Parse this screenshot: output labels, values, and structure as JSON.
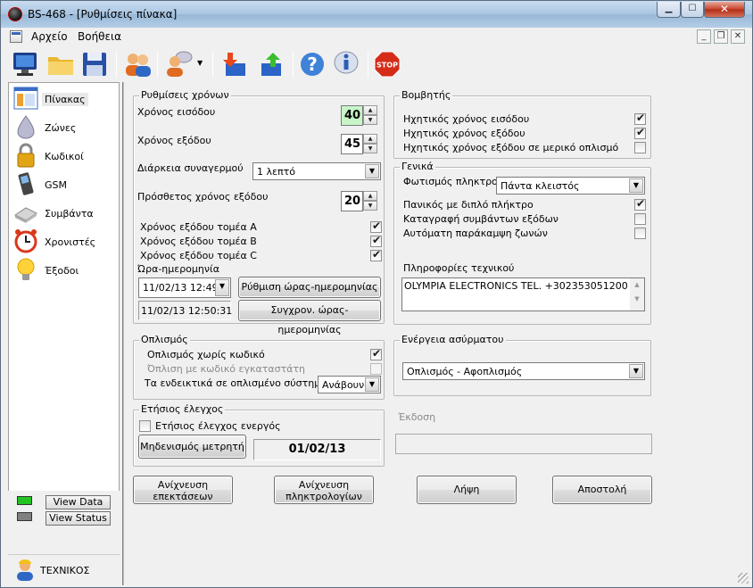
{
  "window": {
    "title": "BS-468 - [Ρυθμίσεις πίνακα]"
  },
  "menu": {
    "file": "Αρχείο",
    "help": "Βοήθεια"
  },
  "nav": {
    "items": [
      {
        "label": "Πίνακας",
        "icon": "panel-icon"
      },
      {
        "label": "Ζώνες",
        "icon": "zones-icon"
      },
      {
        "label": "Κωδικοί",
        "icon": "lock-icon"
      },
      {
        "label": "GSM",
        "icon": "phone-icon"
      },
      {
        "label": "Συμβάντα",
        "icon": "events-icon"
      },
      {
        "label": "Χρονιστές",
        "icon": "alarm-clock-icon"
      },
      {
        "label": "Έξοδοι",
        "icon": "lightbulb-icon"
      }
    ],
    "view_data": "View Data",
    "view_status": "View Status",
    "user": "ΤΕΧΝΙΚΟΣ"
  },
  "timers": {
    "title": "Ρυθμίσεις χρόνων",
    "entry_label": "Χρόνος εισόδου",
    "entry_value": "40",
    "exit_label": "Χρόνος εξόδου",
    "exit_value": "45",
    "alarm_duration_label": "Διάρκεια συναγερμού",
    "alarm_duration_value": "1 λεπτό",
    "extra_exit_label": "Πρόσθετος χρόνος εξόδου",
    "extra_exit_value": "20",
    "sector_a_label": "Χρόνος εξόδου τομέα A",
    "sector_b_label": "Χρόνος εξόδου τομέα B",
    "sector_c_label": "Χρόνος εξόδου τομέα C",
    "datetime_label": "Ώρα-ημερομηνία",
    "datetime_picker": "11/02/13  12:49",
    "datetime_current": "11/02/13   12:50:31",
    "set_datetime_btn": "Ρύθμιση ώρας-ημερομηνίας",
    "sync_datetime_btn": "Συγχρον. ώρας-ημερομηνίας"
  },
  "arming": {
    "title": "Οπλισμός",
    "no_code_label": "Οπλισμός χωρίς κωδικό",
    "installer_code_label": "Όπλιση με κωδικό εγκαταστάτη",
    "indicators_label": "Τα ενδεικτικά σε οπλισμένο σύστημα",
    "indicators_value": "Ανάβουν"
  },
  "annual": {
    "title": "Ετήσιος έλεγχος",
    "active_label": "Ετήσιος έλεγχος ενεργός",
    "reset_btn": "Μηδενισμός μετρητή",
    "date": "01/02/13"
  },
  "buzzer": {
    "title": "Βομβητής",
    "entry_label": "Ηχητικός χρόνος εισόδου",
    "exit_label": "Ηχητικός χρόνος εξόδου",
    "partial_label": "Ηχητικός χρόνος εξόδου σε μερικό οπλισμό"
  },
  "general": {
    "title": "Γενικά",
    "keypad_light_label": "Φωτισμός πληκτρολ.",
    "keypad_light_value": "Πάντα κλειστός",
    "panic_label": "Πανικός με διπλό πλήκτρο",
    "log_exits_label": "Καταγραφή συμβάντων εξόδων",
    "auto_bypass_label": "Αυτόματη παράκαμψη ζωνών",
    "tech_info_label": "Πληροφορίες τεχνικού",
    "tech_info_value": "OLYMPIA ELECTRONICS   TEL. +302353051200"
  },
  "wireless": {
    "title": "Ενέργεια ασύρματου",
    "value": "Οπλισμός - Αφοπλισμός"
  },
  "version": {
    "label": "Έκδοση",
    "value": ""
  },
  "actions": {
    "scan_extensions_line1": "Ανίχνευση",
    "scan_extensions_line2": "επεκτάσεων",
    "scan_keypads_line1": "Ανίχνευση",
    "scan_keypads_line2": "πληκτρολογίων",
    "receive": "Λήψη",
    "send": "Αποστολή"
  },
  "colors": {
    "view_data_led": "#22c322",
    "view_status_led": "#808080",
    "highlight_spin": "#c8f5c8",
    "stop": "#d62b18"
  }
}
